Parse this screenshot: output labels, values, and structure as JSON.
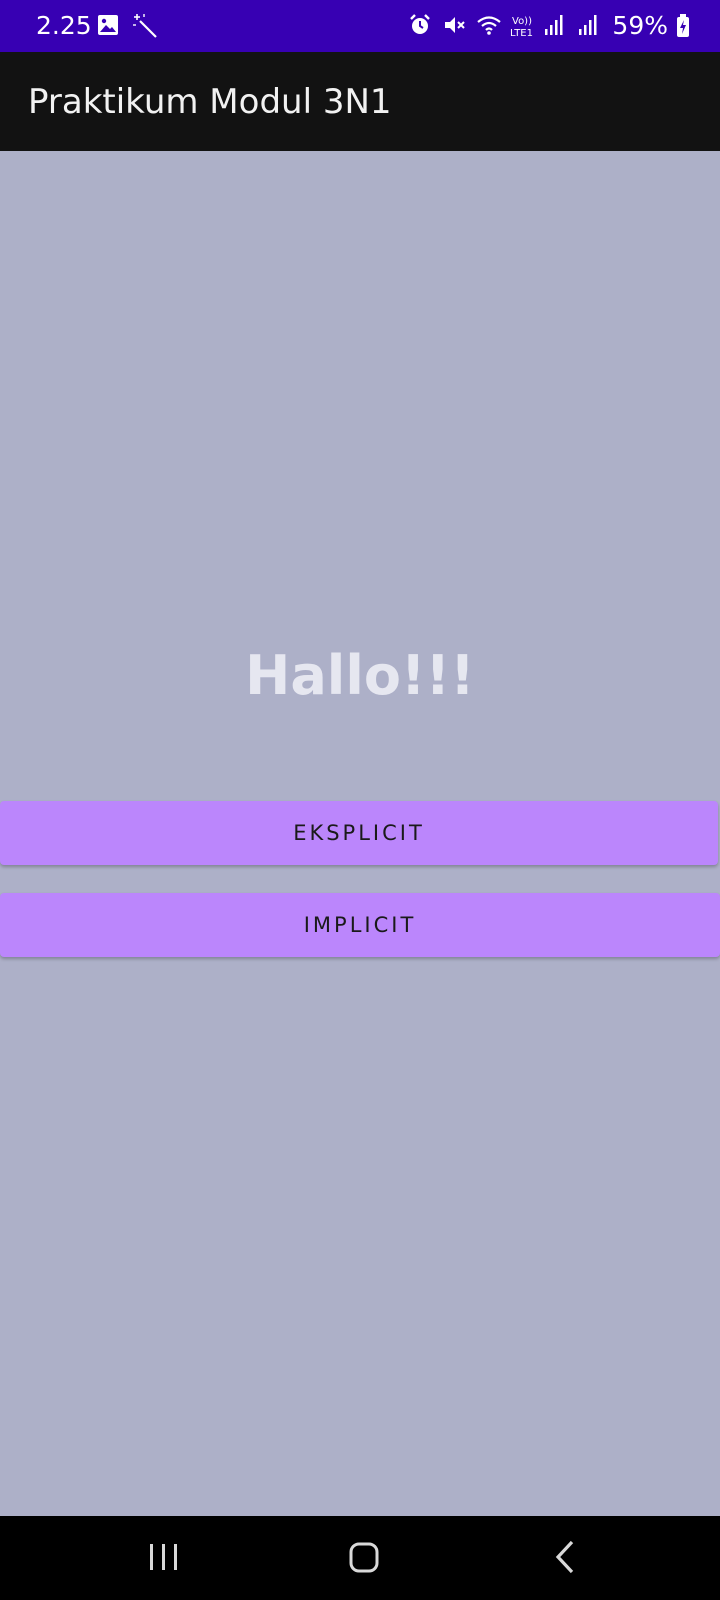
{
  "status_bar": {
    "time": "2.25",
    "battery": "59%",
    "left_icons": [
      "image-icon",
      "magic-wand-icon"
    ],
    "right_icons": [
      "alarm-icon",
      "mute-icon",
      "wifi-icon",
      "volte-icon",
      "signal-icon",
      "signal-icon-2",
      "battery-icon"
    ],
    "background": "#3700b3"
  },
  "app_bar": {
    "title": "Praktikum Modul 3N1",
    "background": "#121212"
  },
  "main": {
    "greeting": "Hallo!!!",
    "buttons": {
      "eksplicit": "EKSPLICIT",
      "implicit": "IMPLICIT"
    },
    "background": "#adb0c8",
    "button_color": "#bb86fc"
  },
  "nav_bar": {
    "icons": [
      "recents-icon",
      "home-icon",
      "back-icon"
    ]
  }
}
